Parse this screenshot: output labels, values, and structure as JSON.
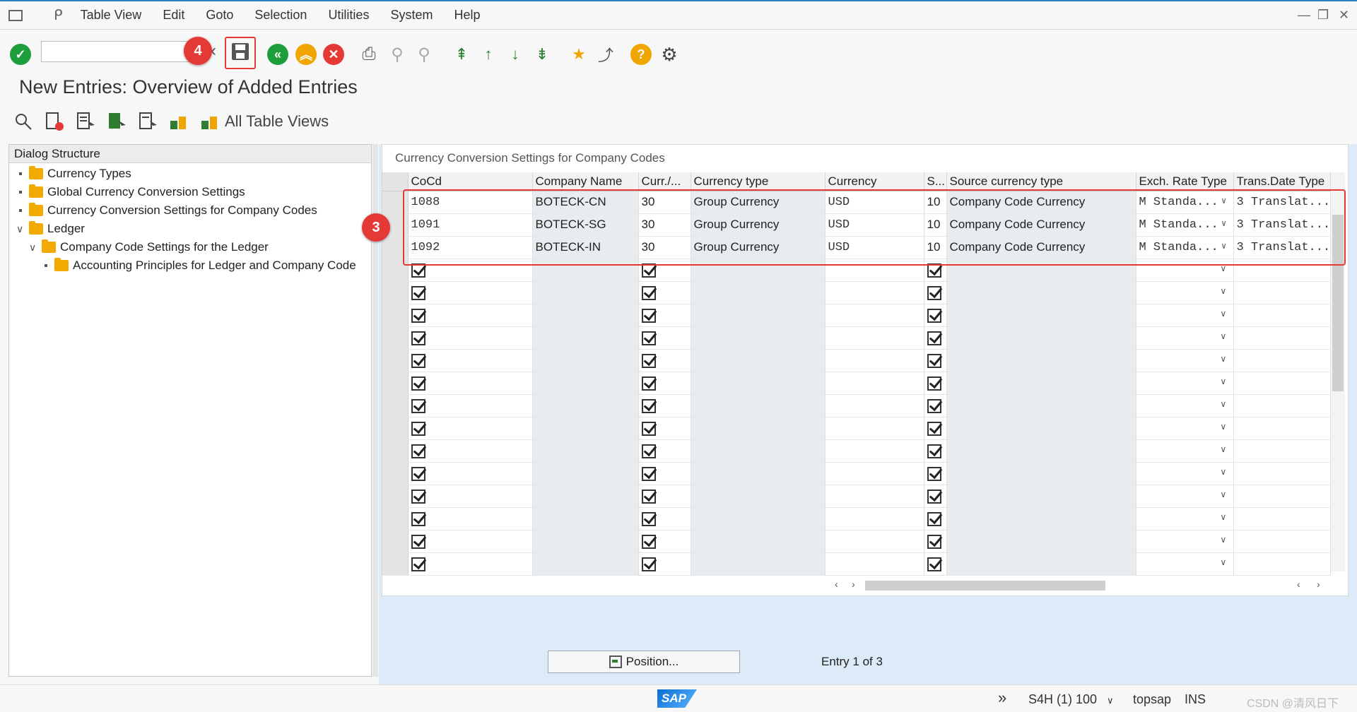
{
  "menubar": {
    "items": [
      "Table View",
      "Edit",
      "Goto",
      "Selection",
      "Utilities",
      "System",
      "Help"
    ]
  },
  "toolbar": {
    "command_value": "",
    "callout_save": "4"
  },
  "page": {
    "title": "New Entries: Overview of Added Entries",
    "all_table_views": "All Table Views"
  },
  "dialog": {
    "header": "Dialog Structure",
    "nodes": [
      "Currency Types",
      "Global Currency Conversion Settings",
      "Currency Conversion Settings for Company Codes",
      "Ledger",
      "Company Code Settings for the Ledger",
      "Accounting Principles for Ledger and Company Code"
    ]
  },
  "table": {
    "title": "Currency Conversion Settings for Company Codes",
    "columns": [
      "CoCd",
      "Company Name",
      "Curr./...",
      "Currency type",
      "Currency",
      "S...",
      "Source currency type",
      "Exch. Rate Type",
      "Trans.Date Type"
    ],
    "rows": [
      [
        "1088",
        "BOTECK-CN",
        "30",
        "Group Currency",
        "USD",
        "10",
        "Company Code Currency",
        "M  Standa...",
        "3  Translat..."
      ],
      [
        "1091",
        "BOTECK-SG",
        "30",
        "Group Currency",
        "USD",
        "10",
        "Company Code Currency",
        "M  Standa...",
        "3  Translat..."
      ],
      [
        "1092",
        "BOTECK-IN",
        "30",
        "Group Currency",
        "USD",
        "10",
        "Company Code Currency",
        "M  Standa...",
        "3  Translat..."
      ]
    ],
    "callout_rows": "3"
  },
  "footer": {
    "position_button": "Position...",
    "entry_info": "Entry 1 of 3"
  },
  "status": {
    "system": "S4H (1) 100",
    "user": "topsap",
    "mode": "INS",
    "watermark": "CSDN @清风日下"
  },
  "colors": {
    "accent_red": "#e53935",
    "green": "#1e9e3a",
    "orange": "#f0a500",
    "folder": "#f2a900"
  }
}
